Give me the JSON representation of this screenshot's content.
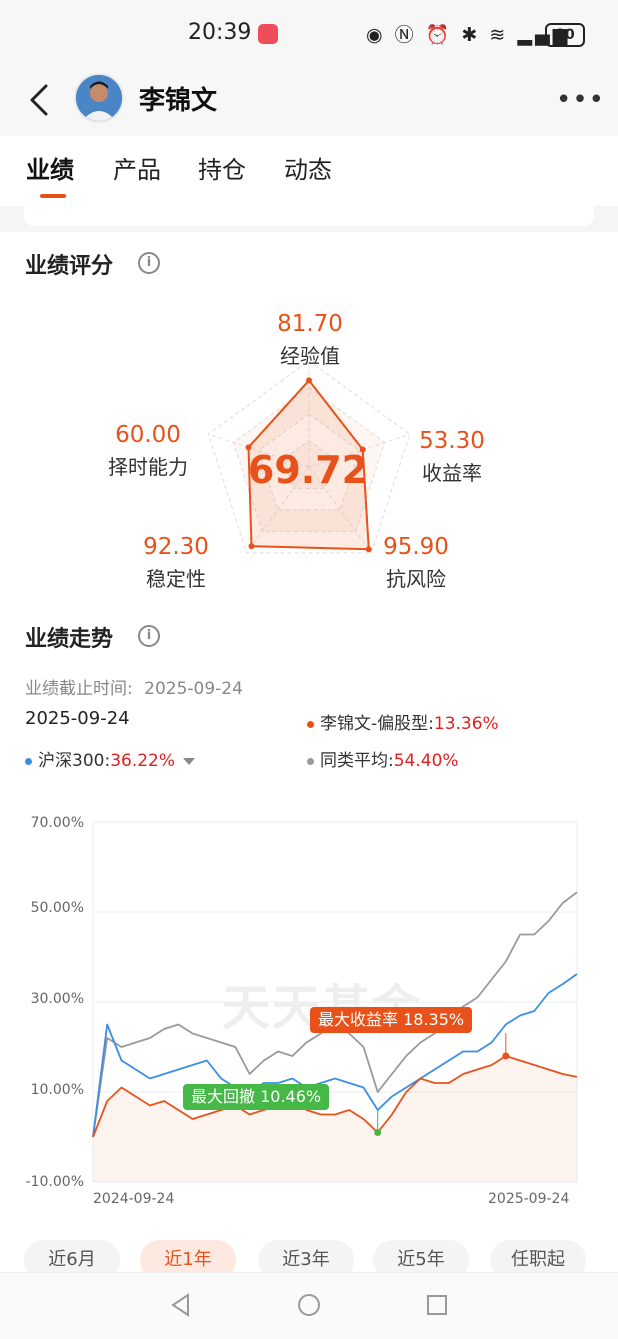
{
  "status_bar": {
    "time": "20:39",
    "battery": "80",
    "icons": [
      "eye-icon",
      "nfc-icon",
      "alarm-icon",
      "bluetooth-icon",
      "wifi-icon",
      "5g-signal-icon"
    ]
  },
  "header": {
    "name": "李锦文"
  },
  "tabs": [
    {
      "label": "业绩",
      "active": true
    },
    {
      "label": "产品",
      "active": false
    },
    {
      "label": "持仓",
      "active": false
    },
    {
      "label": "动态",
      "active": false
    }
  ],
  "score": {
    "title": "业绩评分",
    "overall": "69.72",
    "dimensions": [
      {
        "label": "经验值",
        "value": "81.70"
      },
      {
        "label": "收益率",
        "value": "53.30"
      },
      {
        "label": "抗风险",
        "value": "95.90"
      },
      {
        "label": "稳定性",
        "value": "92.30"
      },
      {
        "label": "择时能力",
        "value": "60.00"
      }
    ]
  },
  "trend": {
    "title": "业绩走势",
    "cutoff_label": "业绩截止时间:",
    "cutoff_date": "2025-09-24",
    "selected_date": "2025-09-24",
    "legend": [
      {
        "name": "李锦文-偏股型:",
        "value": "13.36%",
        "color": "#e8521a"
      },
      {
        "name": "沪深300:",
        "value": "36.22%",
        "color": "#3a8ee6"
      },
      {
        "name": "同类平均:",
        "value": "54.40%",
        "color": "#999999"
      }
    ],
    "watermark": "天天基金",
    "annotations": {
      "max_return": "最大收益率 18.35%",
      "max_drawdown": "最大回撤 10.46%"
    }
  },
  "chart_data": {
    "type": "line",
    "ylim": [
      -10,
      70
    ],
    "yticks": [
      "70.00%",
      "50.00%",
      "30.00%",
      "10.00%",
      "-10.00%"
    ],
    "xticks": [
      "2024-09-24",
      "2025-09-24"
    ],
    "series": [
      {
        "name": "李锦文-偏股型",
        "color": "#e8521a",
        "values": [
          0,
          8,
          11,
          9,
          7,
          8,
          6,
          4,
          5,
          6,
          7,
          5,
          6,
          7,
          8,
          6,
          5,
          5,
          6,
          4,
          1,
          5,
          10,
          13,
          12,
          12,
          14,
          15,
          16,
          18,
          17,
          16,
          15,
          14,
          13.36
        ]
      },
      {
        "name": "沪深300",
        "color": "#3a8ee6",
        "values": [
          0,
          25,
          17,
          15,
          13,
          14,
          15,
          16,
          17,
          13,
          11,
          10,
          12,
          12,
          13,
          11,
          12,
          13,
          12,
          11,
          6,
          9,
          11,
          13,
          15,
          17,
          19,
          19,
          21,
          25,
          27,
          28,
          32,
          34,
          36.22
        ]
      },
      {
        "name": "同类平均",
        "color": "#999999",
        "values": [
          0,
          22,
          20,
          21,
          22,
          24,
          25,
          23,
          22,
          21,
          20,
          14,
          17,
          19,
          18,
          21,
          23,
          25,
          23,
          20,
          10,
          14,
          18,
          21,
          23,
          26,
          29,
          31,
          35,
          39,
          45,
          45,
          48,
          52,
          54.4
        ]
      }
    ]
  },
  "periods": [
    {
      "label": "近6月",
      "active": false
    },
    {
      "label": "近1年",
      "active": true
    },
    {
      "label": "近3年",
      "active": false
    },
    {
      "label": "近5年",
      "active": false
    },
    {
      "label": "任职起",
      "active": false
    }
  ]
}
